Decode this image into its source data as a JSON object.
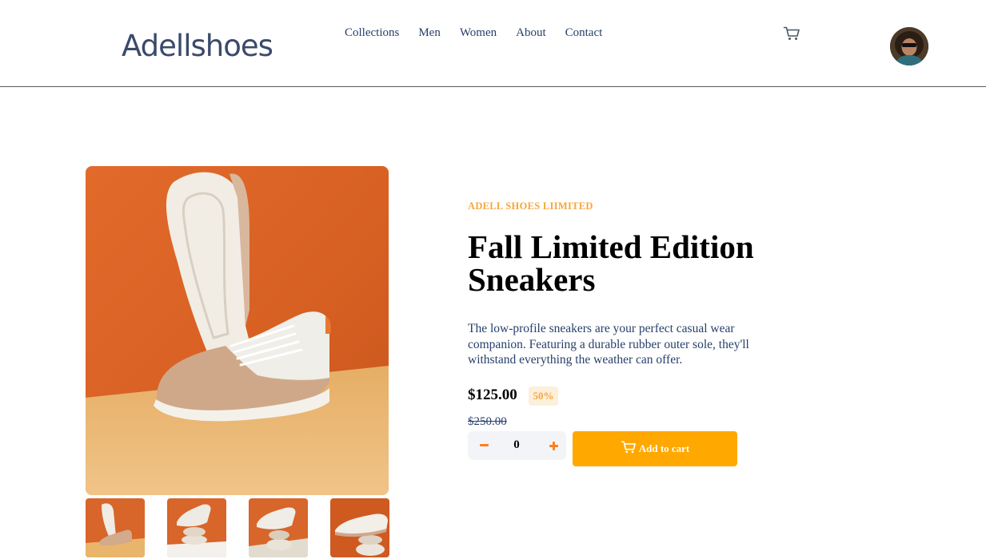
{
  "header": {
    "logo": "Adellshoes",
    "nav": [
      "Collections",
      "Men",
      "Women",
      "About",
      "Contact"
    ],
    "cart_icon": "cart-icon",
    "avatar_icon": "user-avatar"
  },
  "product": {
    "company": "ADELL SHOES LIIMITED",
    "title": "Fall Limited Edition Sneakers",
    "description": "The low-profile sneakers are your perfect casual wear companion. Featuring a durable rubber outer sole, they'll withstand everything the weather can offer.",
    "price": "$125.00",
    "discount": "50%",
    "original_price": "$250.00",
    "quantity": "0",
    "add_to_cart_label": "Add to cart"
  },
  "colors": {
    "accent": "#ffa800",
    "accent_text": "#f6a63c",
    "accent_pale": "#fdefd9",
    "text_dark": "#000000",
    "text_blue": "#27406b",
    "image_orange": "#d8682c",
    "image_sand": "#e8b670"
  },
  "gallery": {
    "main_image_icon": "sneaker-photo",
    "thumbnail_count": 4
  }
}
